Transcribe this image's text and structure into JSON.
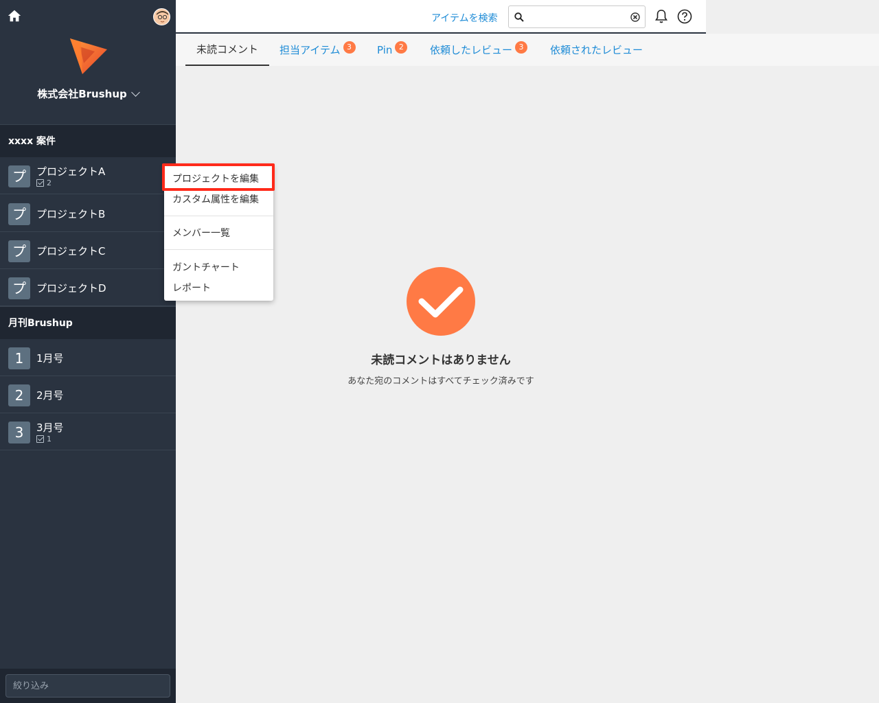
{
  "sidebar": {
    "company_name": "株式会社Brushup",
    "groups": [
      {
        "header": "xxxx 案件",
        "projects": [
          {
            "badge": "プ",
            "name": "プロジェクトA",
            "count": "2"
          },
          {
            "badge": "プ",
            "name": "プロジェクトB"
          },
          {
            "badge": "プ",
            "name": "プロジェクトC"
          },
          {
            "badge": "プ",
            "name": "プロジェクトD"
          }
        ]
      },
      {
        "header": "月刊Brushup",
        "projects": [
          {
            "badge": "1",
            "name": "1月号"
          },
          {
            "badge": "2",
            "name": "2月号"
          },
          {
            "badge": "3",
            "name": "3月号",
            "count": "1"
          }
        ]
      }
    ],
    "filter_placeholder": "絞り込み"
  },
  "topbar": {
    "search_link": "アイテムを検索",
    "search_value": ""
  },
  "tabs": [
    {
      "label": "未読コメント",
      "active": true
    },
    {
      "label": "担当アイテム",
      "badge": "3"
    },
    {
      "label": "Pin",
      "badge": "2"
    },
    {
      "label": "依頼したレビュー",
      "badge": "3"
    },
    {
      "label": "依頼されたレビュー"
    }
  ],
  "empty_state": {
    "title": "未読コメントはありません",
    "subtitle": "あなた宛のコメントはすべてチェック済みです"
  },
  "context_menu": {
    "items": [
      "プロジェクトを編集",
      "カスタム属性を編集",
      "メンバー一覧",
      "ガントチャート",
      "レポート"
    ]
  },
  "colors": {
    "sidebar_bg": "#2a3340",
    "accent": "#ff7a45",
    "link": "#1d8bd6",
    "highlight": "#ff2a1a"
  }
}
